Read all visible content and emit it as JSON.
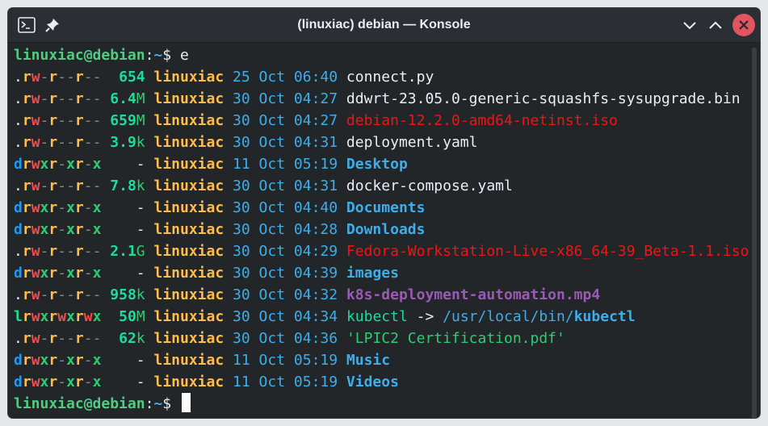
{
  "window": {
    "title": "(linuxiac) debian — Konsole"
  },
  "titlebar_icons": {
    "app": "terminal-app-icon",
    "pin": "pin-icon",
    "minimize": "chevron-down-icon",
    "maximize": "chevron-up-icon",
    "close": "close-icon"
  },
  "colors": {
    "background": "#232629",
    "prompt": "#4fcc83",
    "directory": "#3daee9",
    "user": "#fdbc4b",
    "close": "#e05561"
  },
  "prompt": {
    "user_host": "linuxiac@debian",
    "sep": ":",
    "path": "~",
    "symbol": "$ "
  },
  "command": "e",
  "entries": [
    {
      "perms": ".rw-r--r--",
      "size": "654",
      "user": "linuxiac",
      "date": "25 Oct 06:40",
      "name": "connect.py",
      "kind": "file"
    },
    {
      "perms": ".rw-r--r--",
      "size": "6.4M",
      "user": "linuxiac",
      "date": "30 Oct 04:27",
      "name": "ddwrt-23.05.0-generic-squashfs-sysupgrade.bin",
      "kind": "file"
    },
    {
      "perms": ".rw-r--r--",
      "size": "659M",
      "user": "linuxiac",
      "date": "30 Oct 04:27",
      "name": "debian-12.2.0-amd64-netinst.iso",
      "kind": "archive"
    },
    {
      "perms": ".rw-r--r--",
      "size": "3.9k",
      "user": "linuxiac",
      "date": "30 Oct 04:31",
      "name": "deployment.yaml",
      "kind": "file"
    },
    {
      "perms": "drwxr-xr-x",
      "size": "-",
      "user": "linuxiac",
      "date": "11 Oct 05:19",
      "name": "Desktop",
      "kind": "dir"
    },
    {
      "perms": ".rw-r--r--",
      "size": "7.8k",
      "user": "linuxiac",
      "date": "30 Oct 04:31",
      "name": "docker-compose.yaml",
      "kind": "file"
    },
    {
      "perms": "drwxr-xr-x",
      "size": "-",
      "user": "linuxiac",
      "date": "30 Oct 04:40",
      "name": "Documents",
      "kind": "dir"
    },
    {
      "perms": "drwxr-xr-x",
      "size": "-",
      "user": "linuxiac",
      "date": "30 Oct 04:28",
      "name": "Downloads",
      "kind": "dir"
    },
    {
      "perms": ".rw-r--r--",
      "size": "2.1G",
      "user": "linuxiac",
      "date": "30 Oct 04:29",
      "name": "Fedora-Workstation-Live-x86_64-39_Beta-1.1.iso",
      "kind": "archive"
    },
    {
      "perms": "drwxr-xr-x",
      "size": "-",
      "user": "linuxiac",
      "date": "30 Oct 04:39",
      "name": "images",
      "kind": "dir"
    },
    {
      "perms": ".rw-r--r--",
      "size": "958k",
      "user": "linuxiac",
      "date": "30 Oct 04:32",
      "name": "k8s-deployment-automation.mp4",
      "kind": "video"
    },
    {
      "perms": "lrwxrwxrwx",
      "size": "50M",
      "user": "linuxiac",
      "date": "30 Oct 04:34",
      "name": "kubectl",
      "kind": "link",
      "arrow": " -> ",
      "target_dir": "/usr/local/bin/",
      "target_name": "kubectl"
    },
    {
      "perms": ".rw-r--r--",
      "size": "62k",
      "user": "linuxiac",
      "date": "30 Oct 04:36",
      "name": "'LPIC2 Certification.pdf'",
      "kind": "quoted"
    },
    {
      "perms": "drwxr-xr-x",
      "size": "-",
      "user": "linuxiac",
      "date": "11 Oct 05:19",
      "name": "Music",
      "kind": "dir"
    },
    {
      "perms": "drwxr-xr-x",
      "size": "-",
      "user": "linuxiac",
      "date": "11 Oct 05:19",
      "name": "Videos",
      "kind": "dir"
    }
  ]
}
